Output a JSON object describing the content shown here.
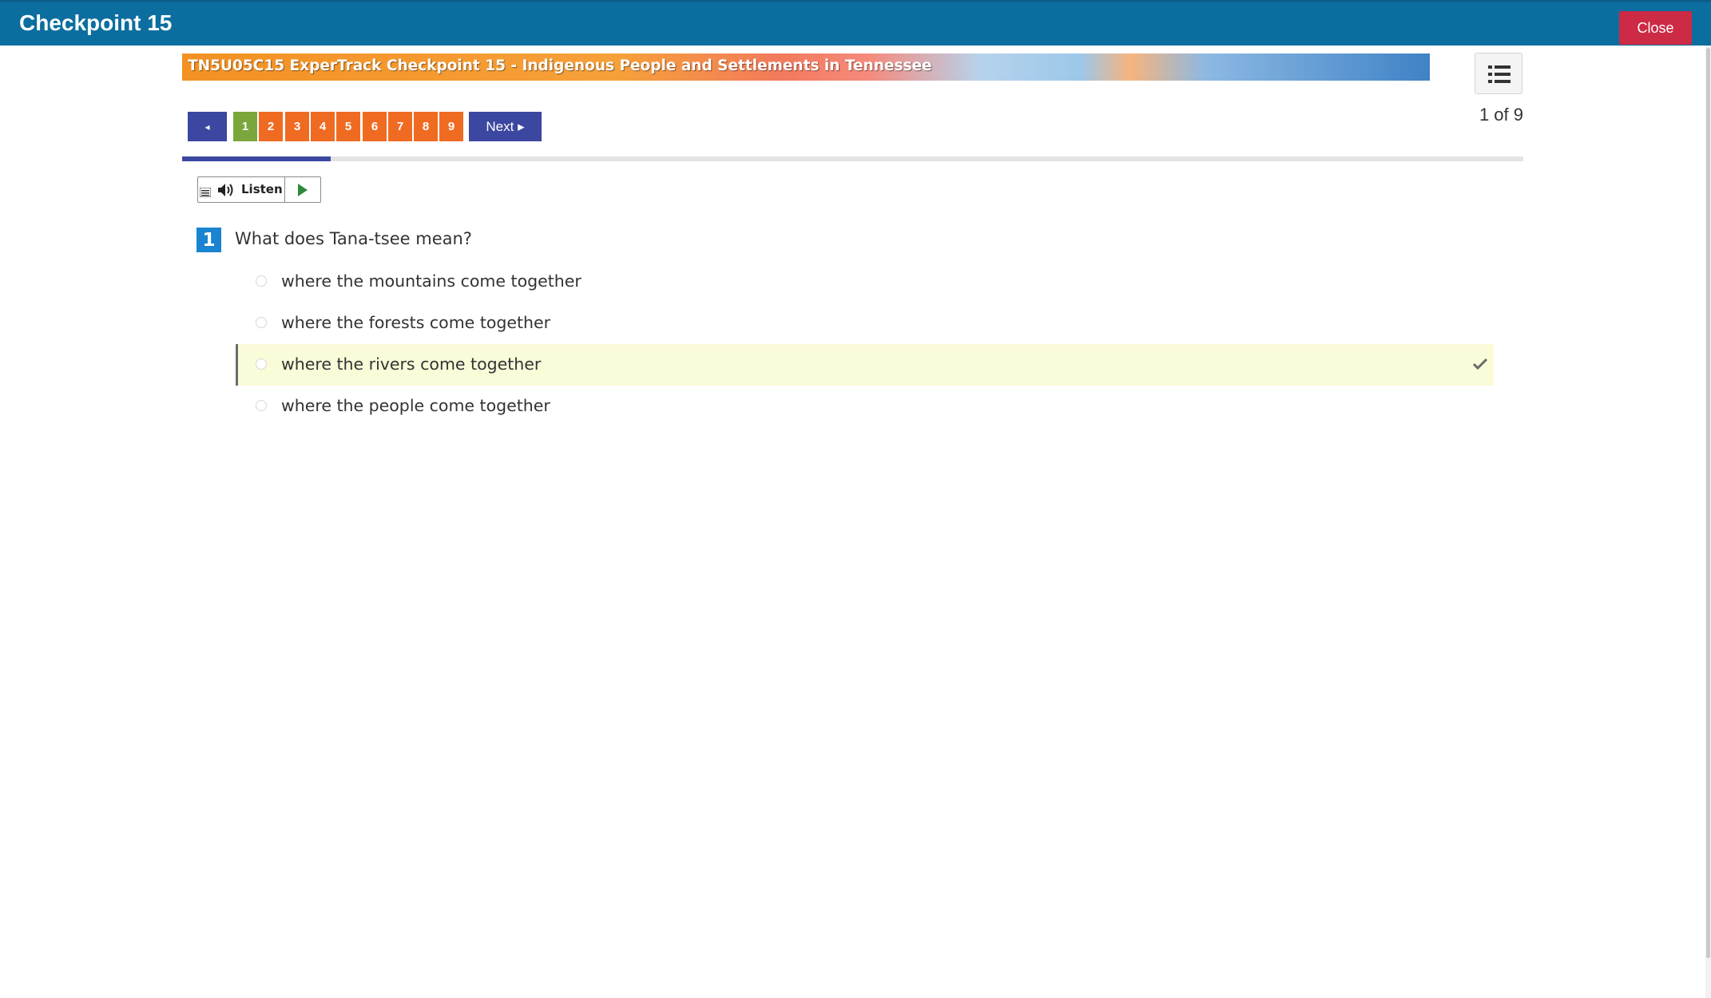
{
  "window": {
    "title": "Checkpoint 15",
    "close_label": "Close"
  },
  "banner": {
    "title": "TN5U05C15 ExperTrack Checkpoint 15 - Indigenous People and Settlements in Tennessee"
  },
  "pager": {
    "prev_label": "◂",
    "next_label": "Next ▸",
    "pages": [
      "1",
      "2",
      "3",
      "4",
      "5",
      "6",
      "7",
      "8",
      "9"
    ],
    "current_page": 1,
    "count_text": "1 of 9",
    "progress_fraction": 0.111
  },
  "listen": {
    "label": "Listen"
  },
  "question": {
    "number": "1",
    "text": "What does Tana-tsee mean?",
    "options": [
      {
        "label": "where the mountains come together",
        "selected": false
      },
      {
        "label": "where the forests come together",
        "selected": false
      },
      {
        "label": "where the rivers come together",
        "selected": true
      },
      {
        "label": "where the people come together",
        "selected": false
      }
    ]
  },
  "colors": {
    "header_bg": "#0b6e9f",
    "close_bg": "#cc2a45",
    "nav_bg": "#3b47a0",
    "page_bg": "#f06b22",
    "current_page_bg": "#7ba63c",
    "question_badge": "#1a84d0",
    "selected_bg": "#fafbd8"
  },
  "icons": {
    "menu": "list-icon",
    "listen": "speaker-icon",
    "play": "play-icon",
    "selected": "checkmark-icon"
  }
}
